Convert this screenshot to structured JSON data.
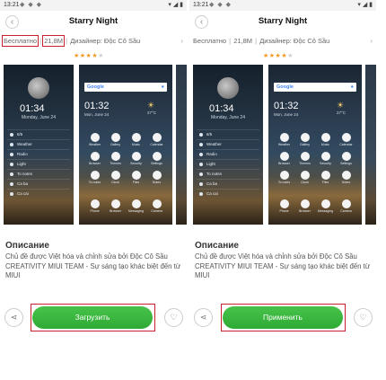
{
  "status": {
    "time": "13:21",
    "right_icons": "▾ ◢ ▮"
  },
  "header": {
    "back_icon": "‹",
    "title": "Starry Night"
  },
  "meta": {
    "price": "Бесплатно",
    "size": "21,8M",
    "designer": "Дизайнер: Độc Cô Sầu",
    "rating": 4,
    "max_rating": 5
  },
  "preview_lock": {
    "time": "01:34",
    "date": "Monday, June 24",
    "items": [
      "8/5",
      "Weather",
      "Radio",
      "Light",
      "To notes",
      "Ca ba",
      "Ca cai"
    ]
  },
  "preview_home": {
    "search_label": "Google",
    "time": "01:32",
    "date": "Mon, June 24",
    "temp": "27°C",
    "apps": [
      "Weather",
      "Gallery",
      "Music",
      "Calendar",
      "Browser",
      "Themes",
      "Security",
      "Settings",
      "To notes",
      "Clock",
      "Files",
      "Notes"
    ],
    "dock": [
      "Phone",
      "Browser",
      "Messaging",
      "Camera"
    ]
  },
  "description": {
    "title": "Описание",
    "text": "Chủ đề được Việt hóa và chỉnh sửa bởi Độc Cô Sầu CREATIVITY MIUI TEAM - Sự sáng tạo khác biệt đến từ MIUI"
  },
  "actions": {
    "share_icon": "share-icon",
    "fav_icon": "heart-icon",
    "download_label": "Загрузить",
    "apply_label": "Применить"
  },
  "colors": {
    "accent_green": "#3bb53f",
    "highlight_red": "#c8202f",
    "star_orange": "#f39b25"
  }
}
